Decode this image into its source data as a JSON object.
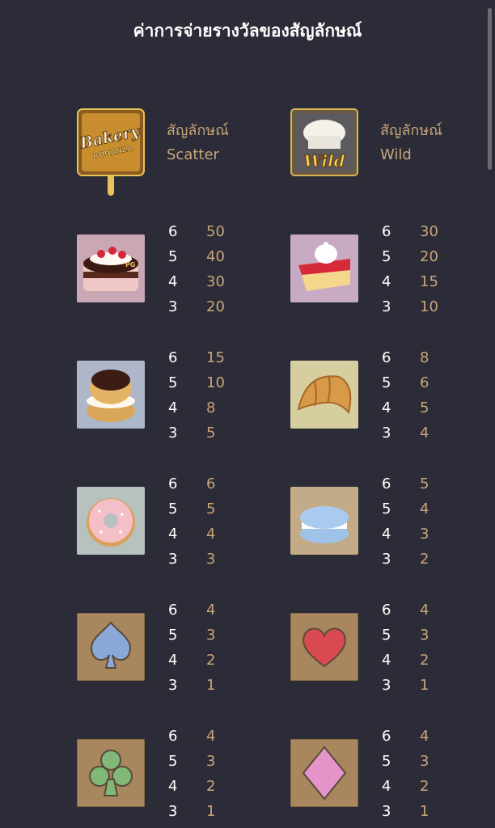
{
  "title": "ค่าการจ่ายรางวัลของสัญลักษณ์",
  "special": [
    {
      "icon": "bakery-bonanza-scatter-icon",
      "logo_top": "Bakery",
      "logo_bottom": "BONANZA",
      "label1": "สัญลักษณ์",
      "label2": "Scatter"
    },
    {
      "icon": "chef-hat-wild-icon",
      "logo_text": "Wild",
      "label1": "สัญลักษณ์",
      "label2": "Wild"
    }
  ],
  "symbols": [
    {
      "icon": "strawberry-cake-icon",
      "badge": "PG",
      "pays": [
        [
          "6",
          "50"
        ],
        [
          "5",
          "40"
        ],
        [
          "4",
          "30"
        ],
        [
          "3",
          "20"
        ]
      ]
    },
    {
      "icon": "cherry-pie-slice-icon",
      "pays": [
        [
          "6",
          "30"
        ],
        [
          "5",
          "20"
        ],
        [
          "4",
          "15"
        ],
        [
          "3",
          "10"
        ]
      ]
    },
    {
      "icon": "cream-puff-icon",
      "pays": [
        [
          "6",
          "15"
        ],
        [
          "5",
          "10"
        ],
        [
          "4",
          "8"
        ],
        [
          "3",
          "5"
        ]
      ]
    },
    {
      "icon": "croissant-icon",
      "pays": [
        [
          "6",
          "8"
        ],
        [
          "5",
          "6"
        ],
        [
          "4",
          "5"
        ],
        [
          "3",
          "4"
        ]
      ]
    },
    {
      "icon": "donut-icon",
      "pays": [
        [
          "6",
          "6"
        ],
        [
          "5",
          "5"
        ],
        [
          "4",
          "4"
        ],
        [
          "3",
          "3"
        ]
      ]
    },
    {
      "icon": "macaron-icon",
      "pays": [
        [
          "6",
          "5"
        ],
        [
          "5",
          "4"
        ],
        [
          "4",
          "3"
        ],
        [
          "3",
          "2"
        ]
      ]
    },
    {
      "icon": "spade-icon",
      "pays": [
        [
          "6",
          "4"
        ],
        [
          "5",
          "3"
        ],
        [
          "4",
          "2"
        ],
        [
          "3",
          "1"
        ]
      ]
    },
    {
      "icon": "heart-icon",
      "pays": [
        [
          "6",
          "4"
        ],
        [
          "5",
          "3"
        ],
        [
          "4",
          "2"
        ],
        [
          "3",
          "1"
        ]
      ]
    },
    {
      "icon": "club-icon",
      "pays": [
        [
          "6",
          "4"
        ],
        [
          "5",
          "3"
        ],
        [
          "4",
          "2"
        ],
        [
          "3",
          "1"
        ]
      ]
    },
    {
      "icon": "diamond-icon",
      "pays": [
        [
          "6",
          "4"
        ],
        [
          "5",
          "3"
        ],
        [
          "4",
          "2"
        ],
        [
          "3",
          "1"
        ]
      ]
    }
  ],
  "colors": {
    "background": "#2b2c37",
    "value": "#c9a57a",
    "count": "#ffffff"
  }
}
